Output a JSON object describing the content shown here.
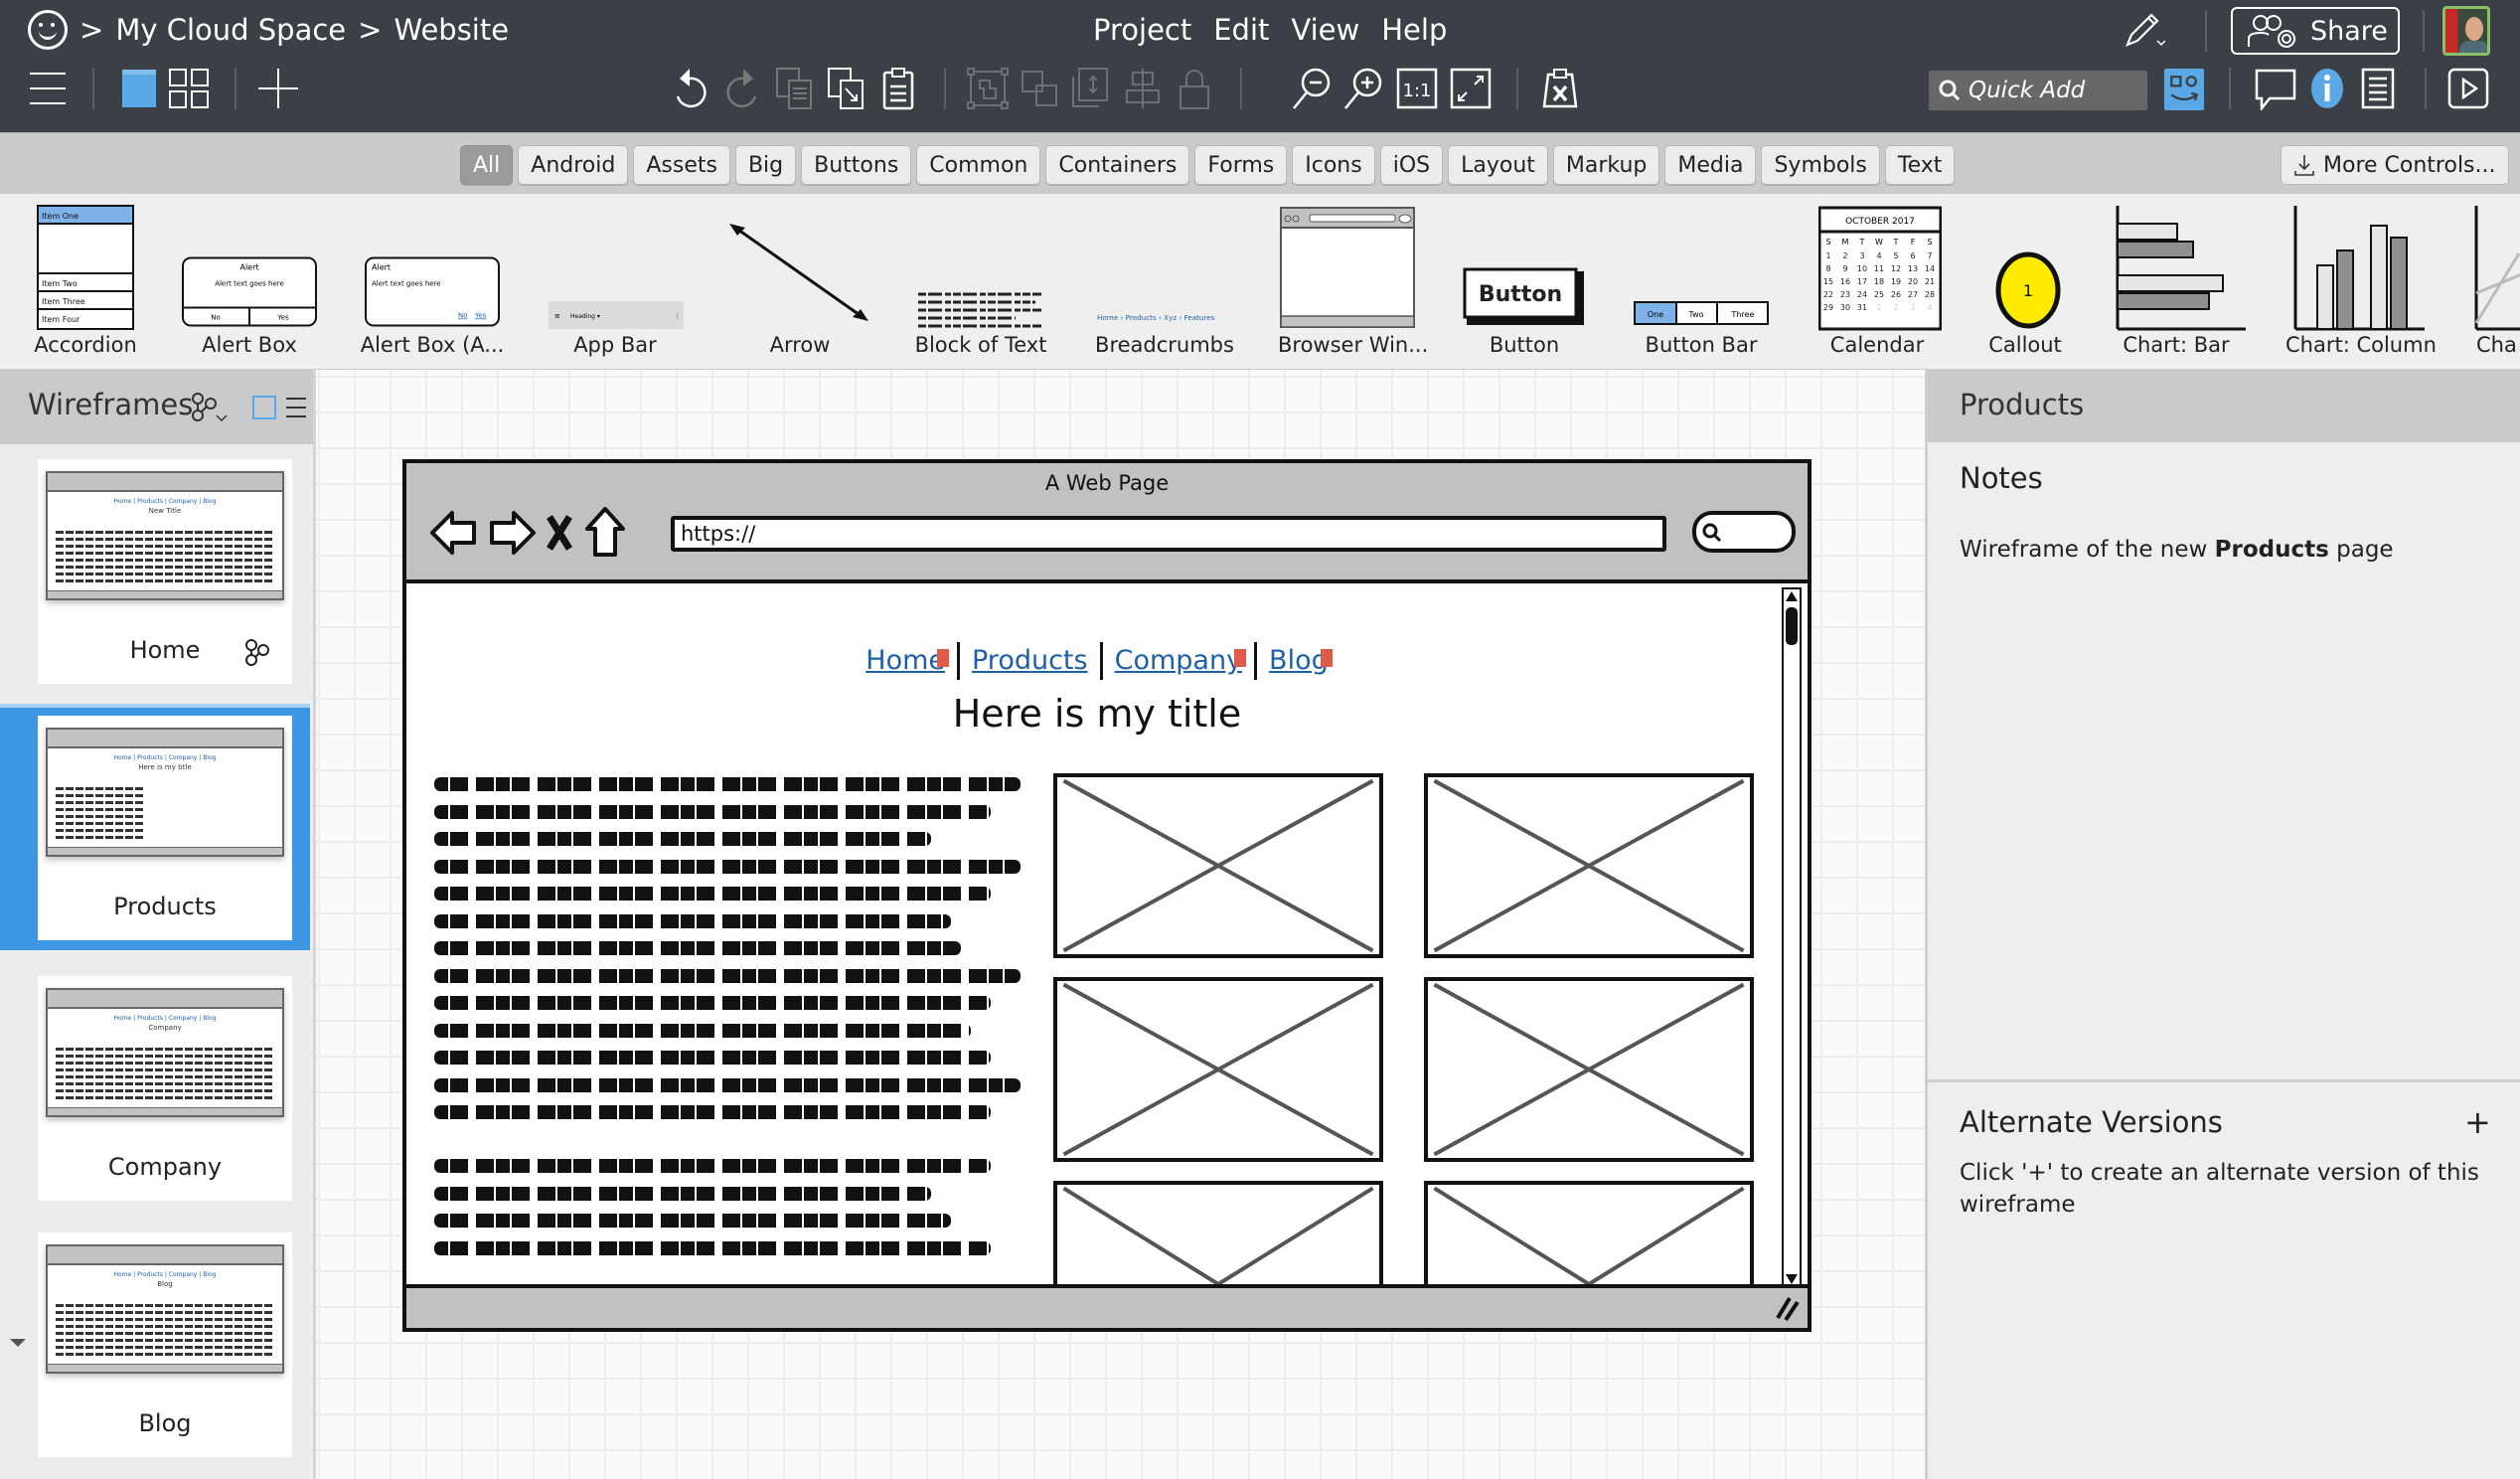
{
  "header": {
    "breadcrumb": [
      ">",
      "My Cloud Space",
      ">",
      "Website"
    ],
    "menu": [
      "Project",
      "Edit",
      "View",
      "Help"
    ],
    "share_label": "Share",
    "quick_add_placeholder": "Quick Add",
    "accent_color": "#5aa9e6",
    "toolbar_left": [
      "hamburger-menu-icon",
      "single-view-icon",
      "grid-view-icon",
      "add-icon"
    ],
    "toolbar_edit": [
      "undo-icon",
      "redo-icon",
      "duplicate-icon",
      "paste-special-icon",
      "clipboard-icon"
    ],
    "toolbar_arrange": [
      "group-icon",
      "ungroup-icon",
      "arrange-icon",
      "align-icon",
      "lock-icon"
    ],
    "toolbar_zoom": [
      "zoom-out-icon",
      "zoom-in-icon",
      "actual-size-icon",
      "fit-icon"
    ],
    "toolbar_misc": [
      "clear-clipboard-icon"
    ],
    "actual_size_label": "1:1"
  },
  "filters": {
    "items": [
      "All",
      "Android",
      "Assets",
      "Big",
      "Buttons",
      "Common",
      "Containers",
      "Forms",
      "Icons",
      "iOS",
      "Layout",
      "Markup",
      "Media",
      "Symbols",
      "Text"
    ],
    "active": "All",
    "more_label": "More Controls..."
  },
  "components": [
    {
      "label": "Accordion",
      "items": [
        "Item One",
        "Item Two",
        "Item Three",
        "Item Four"
      ]
    },
    {
      "label": "Alert Box",
      "title": "Alert",
      "text": "Alert text goes here",
      "buttons": [
        "No",
        "Yes"
      ]
    },
    {
      "label": "Alert Box (A...",
      "title": "Alert",
      "text": "Alert text goes here",
      "buttons": [
        "No",
        "Yes"
      ]
    },
    {
      "label": "App Bar",
      "text": "Heading ▾"
    },
    {
      "label": "Arrow"
    },
    {
      "label": "Block of Text"
    },
    {
      "label": "Breadcrumbs",
      "text": "Home › Products › Xyz › Features"
    },
    {
      "label": "Browser Win..."
    },
    {
      "label": "Button",
      "text": "Button"
    },
    {
      "label": "Button Bar",
      "buttons": [
        "One",
        "Two",
        "Three"
      ]
    },
    {
      "label": "Calendar",
      "month": "OCTOBER 2017"
    },
    {
      "label": "Callout",
      "text": "1"
    },
    {
      "label": "Chart: Bar"
    },
    {
      "label": "Chart: Column"
    },
    {
      "label": "Cha"
    }
  ],
  "sidebar": {
    "title": "Wireframes",
    "items": [
      {
        "name": "Home",
        "mini_title": "New Title",
        "has_link_icon": true
      },
      {
        "name": "Products",
        "mini_title": "Here is my title",
        "selected": true
      },
      {
        "name": "Company",
        "mini_title": "Company"
      },
      {
        "name": "Blog",
        "mini_title": "Blog"
      }
    ]
  },
  "wireframe": {
    "window_title": "A Web Page",
    "url": "https://",
    "nav_links": [
      "Home",
      "Products",
      "Company",
      "Blog"
    ],
    "page_title": "Here is my title",
    "image_placeholders": 6
  },
  "right_panel": {
    "title": "Products",
    "notes_heading": "Notes",
    "notes_prefix": "Wireframe of the new ",
    "notes_bold": "Products",
    "notes_suffix": " page",
    "alt_heading": "Alternate Versions",
    "alt_add": "+",
    "alt_text": "Click '+' to create an alternate version of this wireframe"
  }
}
